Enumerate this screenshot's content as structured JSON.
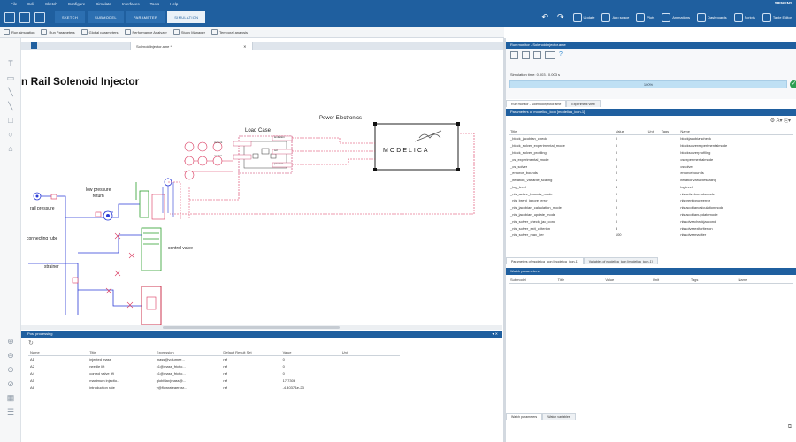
{
  "menu": [
    "File",
    "Edit",
    "Sketch",
    "Configure",
    "Simulate",
    "Interfaces",
    "Tools",
    "Help"
  ],
  "app_right": "SIEMENS",
  "modes": [
    {
      "label": "SKETCH",
      "active": false
    },
    {
      "label": "SUBMODEL",
      "active": false
    },
    {
      "label": "PARAMETER",
      "active": false
    },
    {
      "label": "SIMULATION",
      "active": true
    }
  ],
  "ribbon_tools": [
    "Update",
    "App space",
    "Plots",
    "Animations",
    "Dashboards",
    "Scripts",
    "Table Editor"
  ],
  "sim_toolbar": [
    "Run simulation",
    "Run Parameters",
    "Global parameters",
    "Performance Analyzer",
    "Study Manager",
    "Temporal analysis"
  ],
  "document_tab": "SolenoidInjector.ame *",
  "model": {
    "title": "n Rail Solenoid Injector",
    "load_case": "Load Case",
    "power_electronics": "Power Electronics",
    "modelica_label": "MODELICA",
    "low_pressure": "low pressure\nreturn",
    "rail_pressure": "rail pressure",
    "connecting_tube": "connecting tube",
    "strainer": "strainer",
    "control_valve": "control valve",
    "lc_ports": [
      "current",
      "control",
      "levitation",
      "sol",
      "position"
    ]
  },
  "post_processing": {
    "header": "Post processing",
    "columns": [
      "Name",
      "Title",
      "Expression",
      "Default Result Set",
      "Value",
      "Unit"
    ],
    "rows": [
      [
        "A1",
        "injected mass",
        "mass@volumee...",
        "ref",
        "0",
        ""
      ],
      [
        "A2",
        "needle lift",
        "x1@mass_frictio...",
        "ref",
        "0",
        ""
      ],
      [
        "A4",
        "control valve lift",
        "x1@mass_frictio...",
        "ref",
        "0",
        ""
      ],
      [
        "A5",
        "maximum injectio...",
        "globMax(mass@...",
        "ref",
        "17.7306",
        ""
      ],
      [
        "A6",
        "introduction rate",
        "y@flowrateaerosr...",
        "ref",
        "-4.4037&e-23",
        ""
      ]
    ]
  },
  "run_monitor": {
    "header": "Run monitor - SolenoidInjector.ame",
    "sim_time": "Simulation time: 0.003 / 0.003 s",
    "progress_pct": 100,
    "progress_label": "100%",
    "tabs": [
      "Run monitor - SolenoidInjector.ame",
      "Experiment view"
    ]
  },
  "parameters": {
    "header": "Parameters of modelica_icon [modelica_icon-1]",
    "columns": [
      "Title",
      "Value",
      "Unit",
      "Tags",
      "Name"
    ],
    "rows": [
      [
        "_block_jacobian_check",
        "0",
        "",
        "",
        "blockjacobiancheck"
      ],
      [
        "_block_solver_experimental_mode",
        "0",
        "",
        "",
        "blocksolverexperimentalmode"
      ],
      [
        "_block_solver_profiling",
        "0",
        "",
        "",
        "blocksolverprofiling"
      ],
      [
        "_cs_experimental_mode",
        "0",
        "",
        "",
        "csexperimentalmode"
      ],
      [
        "_cs_solver",
        "0",
        "",
        "",
        "cssolver"
      ],
      [
        "_enforce_bounds",
        "0",
        "",
        "",
        "enforcebounds"
      ],
      [
        "_iteration_variable_scaling",
        "1",
        "",
        "",
        "iterationvariablescaling"
      ],
      [
        "_log_level",
        "3",
        "",
        "",
        "loglevel"
      ],
      [
        "_nls_active_bounds_mode",
        "0",
        "",
        "",
        "nlsactiveboundsmode"
      ],
      [
        "_nls_brent_ignore_error",
        "0",
        "",
        "",
        "nlsbrentignoreerror"
      ],
      [
        "_nls_jacobian_calculation_mode",
        "0",
        "",
        "",
        "nlsjacobiancalculationmode"
      ],
      [
        "_nls_jacobian_update_mode",
        "2",
        "",
        "",
        "nlsjacobianupdatemode"
      ],
      [
        "_nls_solver_check_jac_cond",
        "0",
        "",
        "",
        "nlssolvercheckjaccond"
      ],
      [
        "_nls_solver_exit_criterion",
        "3",
        "",
        "",
        "nlssolverexitcriterion"
      ],
      [
        "_nls_solver_max_iter",
        "100",
        "",
        "",
        "nlssolvermaxiter"
      ]
    ],
    "tabs": [
      "Parameters of modelica_icon [modelica_icon-1]",
      "Variables of modelica_icon [modelica_icon-1]"
    ]
  },
  "watch": {
    "header": "Watch parameters",
    "columns": [
      "Submodel",
      "Title",
      "Value",
      "Unit",
      "Tags",
      "Name"
    ],
    "tabs": [
      "Watch parameters",
      "Watch variables"
    ]
  },
  "colors": {
    "accent": "#1f5f9f",
    "progress": "#bfe0f4",
    "ok": "#2e9e52",
    "hydraulic": "#2b3bd6",
    "mech": "#2a9d2a",
    "signal": "#d9365c"
  }
}
